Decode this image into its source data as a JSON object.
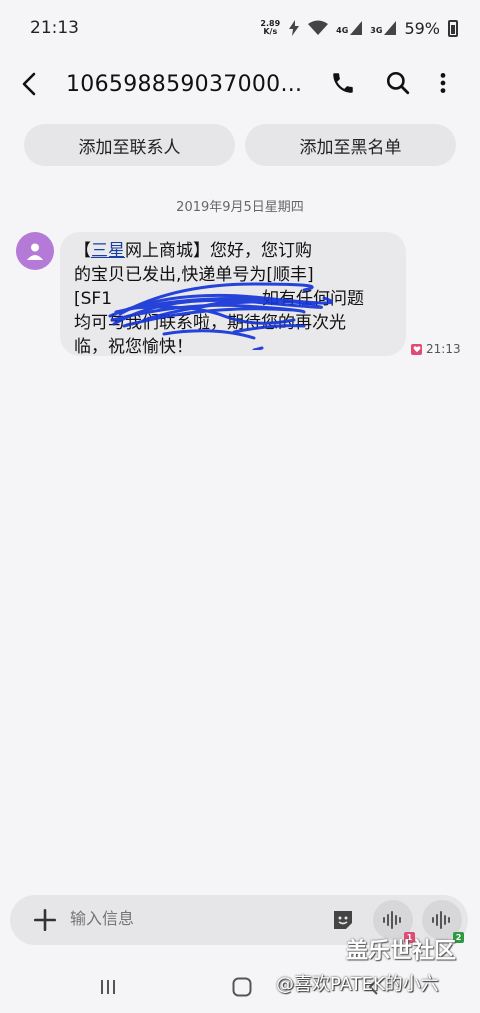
{
  "status_bar": {
    "time": "21:13",
    "net_speed_value": "2.89",
    "net_speed_unit": "K/s",
    "signal_4g": "4G",
    "signal_3g": "3G",
    "battery": "59%"
  },
  "header": {
    "title": "106598859037000...",
    "icons": [
      "back-arrow-icon",
      "phone-icon",
      "search-icon",
      "more-vertical-icon"
    ]
  },
  "actions": {
    "add_contact": "添加至联系人",
    "add_blacklist": "添加至黑名单"
  },
  "conversation": {
    "date": "2019年9月5日星期四",
    "message": {
      "line1_open": "【",
      "line1_link": "三星",
      "line1_rest": "网上商城】您好，您订购",
      "line2": "的宝贝已发出,快递单号为[顺丰]",
      "line3_start": "[SF1",
      "line3_end": "如有任何问题",
      "line4": "均可与我们联系啦，期待您的再次光",
      "line5": "临，祝您愉快！",
      "time": "21:13"
    }
  },
  "composer": {
    "placeholder": "输入信息",
    "sim1": "1",
    "sim2": "2"
  },
  "watermark": {
    "main": "盖乐世社区",
    "sub": "@喜欢PATEK的小六"
  },
  "colors": {
    "background": "#f5f5f7",
    "bubble": "#e9e9eb",
    "avatar": "#b57ad8",
    "link": "#1a3fa3",
    "scribble": "#1534d8"
  }
}
